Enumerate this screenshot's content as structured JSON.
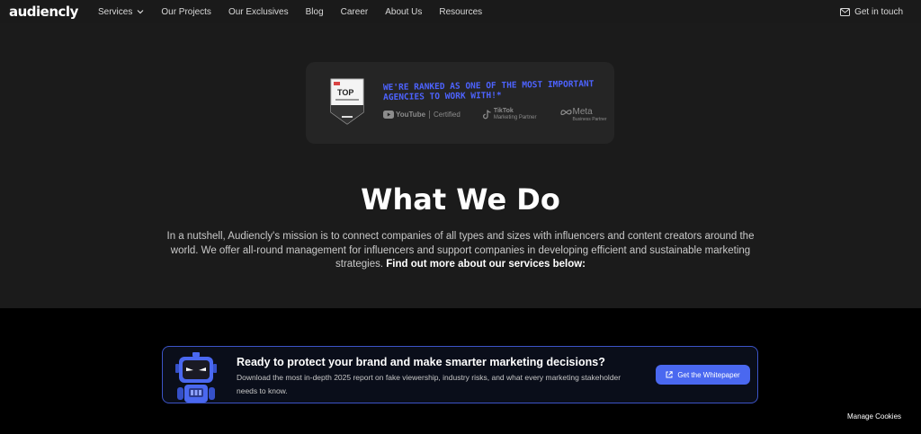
{
  "nav": {
    "logo": "audiencly",
    "links": [
      "Services",
      "Our Projects",
      "Our Exclusives",
      "Blog",
      "Career",
      "About Us",
      "Resources"
    ],
    "contact_label": "Get in touch"
  },
  "badge": {
    "top_label": "TOP",
    "ranked_text": "We're ranked as one of the most important agencies to work with!*",
    "youtube": {
      "brand": "YouTube",
      "cert": "Certified"
    },
    "tiktok": {
      "brand": "TikTok",
      "sub": "Marketing Partner"
    },
    "meta": {
      "brand": "Meta",
      "sub": "Business Partner"
    }
  },
  "hero": {
    "heading": "What We Do",
    "intro": "In a nutshell, Audiencly's mission is to connect companies of all types and sizes with influencers and content creators around the world. We offer all-round management for influencers and support companies in developing efficient and sustainable marketing strategies.",
    "intro_bold": "Find out more about our services below:"
  },
  "banner": {
    "title": "Ready to protect your brand and make smarter marketing decisions?",
    "text": "Download the most in-depth 2025 report on fake viewership, industry risks, and what every marketing stakeholder needs to know.",
    "button": "Get the Whitepaper"
  },
  "cookies": "Manage Cookies",
  "colors": {
    "accent": "#4a68f0",
    "ranked_text": "#4d63ff",
    "hero_bg": "#1b1b1b",
    "nav_bg": "#1a1a1a"
  }
}
